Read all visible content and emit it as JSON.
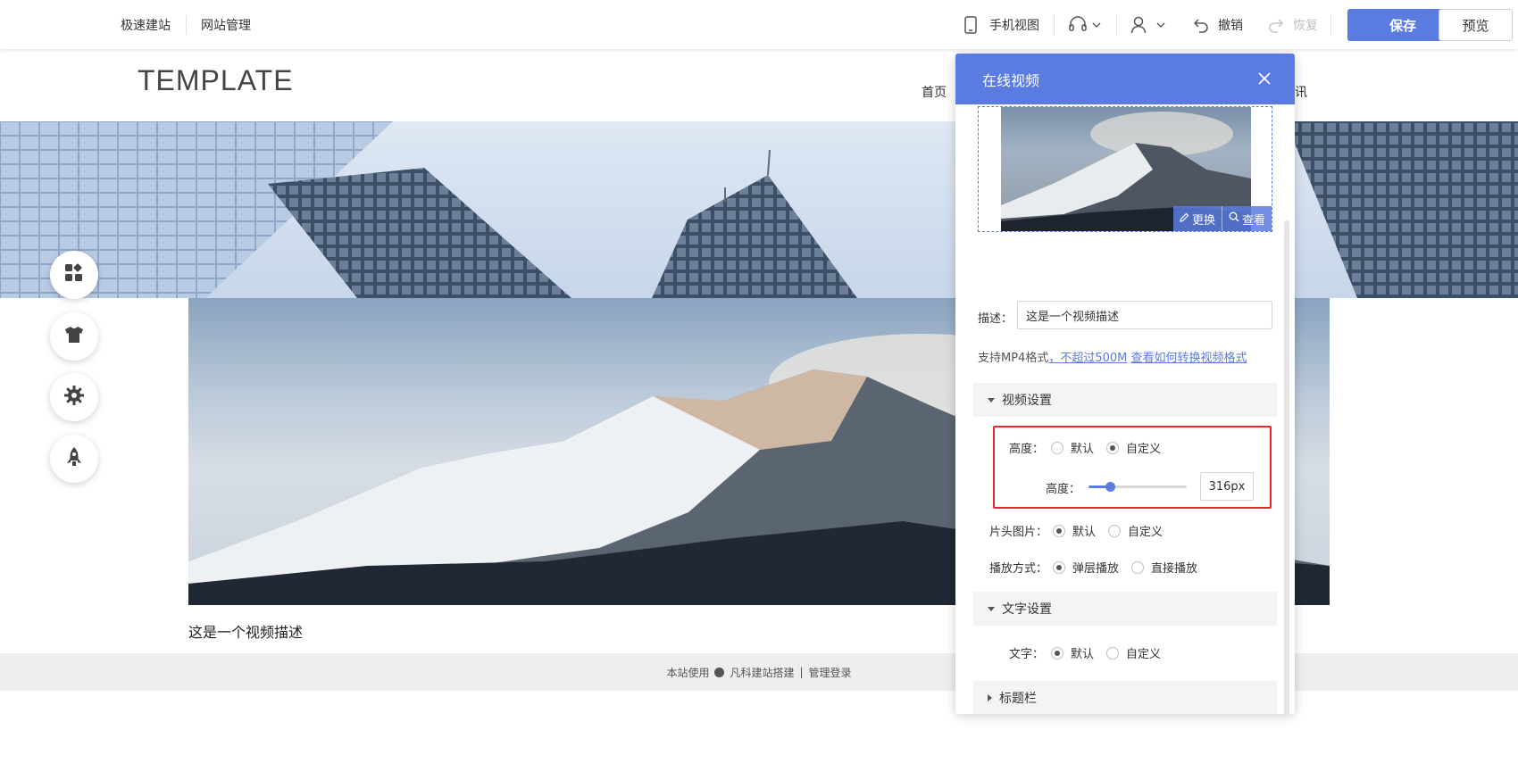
{
  "topbar": {
    "left_links": [
      "极速建站",
      "网站管理"
    ],
    "mobile_view": "手机视图",
    "undo": "撤销",
    "redo": "恢复",
    "save": "保存",
    "preview": "预览"
  },
  "site": {
    "logo": "TEMPLATE",
    "nav": [
      "首页",
      "讯"
    ],
    "video_description": "这是一个视频描述",
    "footer": {
      "powered_prefix": "本站使用",
      "powered_brand": "凡科建站搭建",
      "separator": "|",
      "admin_login": "管理登录"
    }
  },
  "side_tools": [
    "apps-icon",
    "shirt-icon",
    "gear-icon",
    "rocket-icon"
  ],
  "panel": {
    "title": "在线视频",
    "thumb_actions": {
      "replace": "更换",
      "view": "查看"
    },
    "description_label": "描述：",
    "description_value": "这是一个视频描述",
    "hint_prefix": "支持MP4格式",
    "hint_limit": "，不超过500M",
    "hint_link": "查看如何转换视频格式",
    "sections": {
      "video_settings": "视频设置",
      "text_settings": "文字设置",
      "title_bar": "标题栏"
    },
    "height_label": "高度：",
    "height_options": {
      "default": "默认",
      "custom": "自定义",
      "selected": "自定义"
    },
    "height_value_label": "高度：",
    "height_value": "316px",
    "height_slider_fraction": 0.22,
    "poster_label": "片头图片：",
    "poster_options": {
      "default": "默认",
      "custom": "自定义",
      "selected": "默认"
    },
    "play_label": "播放方式：",
    "play_options": {
      "popup": "弹层播放",
      "direct": "直接播放",
      "selected": "弹层播放"
    },
    "text_label": "文字：",
    "text_options": {
      "default": "默认",
      "custom": "自定义",
      "selected": "默认"
    }
  },
  "colors": {
    "accent": "#5a7be0",
    "highlight": "#e8262b"
  }
}
